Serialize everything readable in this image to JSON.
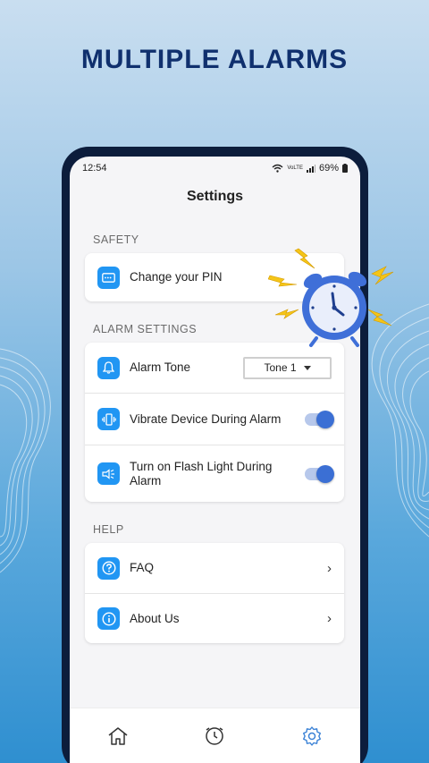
{
  "headline": "MULTIPLE ALARMS",
  "statusbar": {
    "time": "12:54",
    "network": "VoLTE",
    "battery": "69%"
  },
  "screen": {
    "title": "Settings"
  },
  "safety": {
    "section_label": "SAFETY",
    "change_pin": {
      "label": "Change your PIN",
      "icon": "pin-icon"
    }
  },
  "alarm_settings": {
    "section_label": "ALARM SETTINGS",
    "alarm_tone": {
      "label": "Alarm Tone",
      "icon": "bell-icon",
      "selected": "Tone 1"
    },
    "vibrate": {
      "label": "Vibrate Device During Alarm",
      "icon": "vibrate-icon",
      "enabled": true
    },
    "flashlight": {
      "label": "Turn on Flash Light During Alarm",
      "icon": "flashlight-icon",
      "enabled": true
    }
  },
  "help": {
    "section_label": "HELP",
    "faq": {
      "label": "FAQ",
      "icon": "question-icon"
    },
    "about": {
      "label": "About Us",
      "icon": "info-icon"
    }
  },
  "bottom_nav": [
    {
      "name": "home",
      "icon": "home-icon",
      "active": false
    },
    {
      "name": "alarm",
      "icon": "alarm-history-icon",
      "active": false
    },
    {
      "name": "settings",
      "icon": "gear-icon",
      "active": true
    }
  ],
  "colors": {
    "accent": "#2196f3",
    "headline": "#10306e",
    "toggle_on": "#3b6fd4",
    "nav_active": "#3b82d6"
  }
}
